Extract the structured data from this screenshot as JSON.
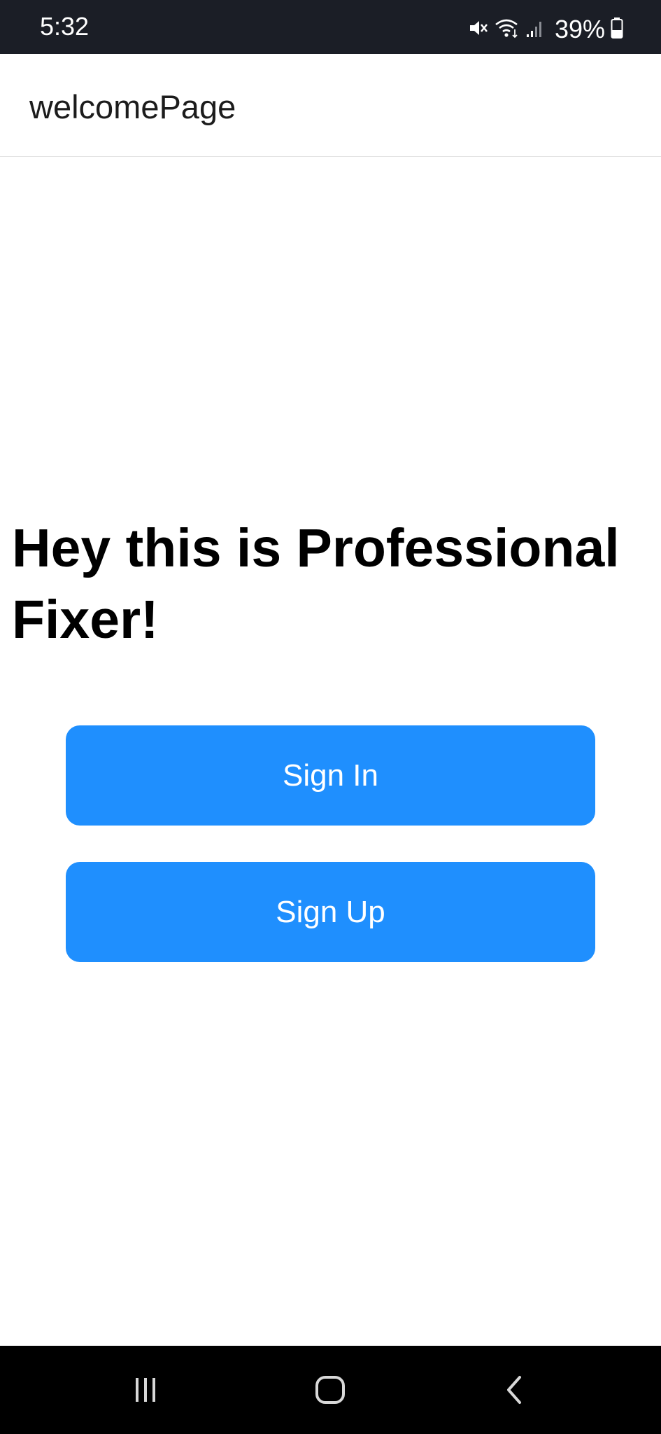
{
  "status_bar": {
    "time": "5:32",
    "battery_percent": "39%",
    "icons": [
      "mute-icon",
      "wifi-icon",
      "signal-icon",
      "battery-icon"
    ]
  },
  "app_bar": {
    "title": "welcomePage"
  },
  "main": {
    "headline": "Hey this is Professional Fixer!",
    "sign_in_label": "Sign In",
    "sign_up_label": "Sign Up"
  },
  "nav_bar": {
    "icons": [
      "recents-icon",
      "home-icon",
      "back-icon"
    ]
  },
  "colors": {
    "status_bar_bg": "#1b1e26",
    "button_bg": "#1f8ffe",
    "nav_bar_bg": "#000000"
  }
}
